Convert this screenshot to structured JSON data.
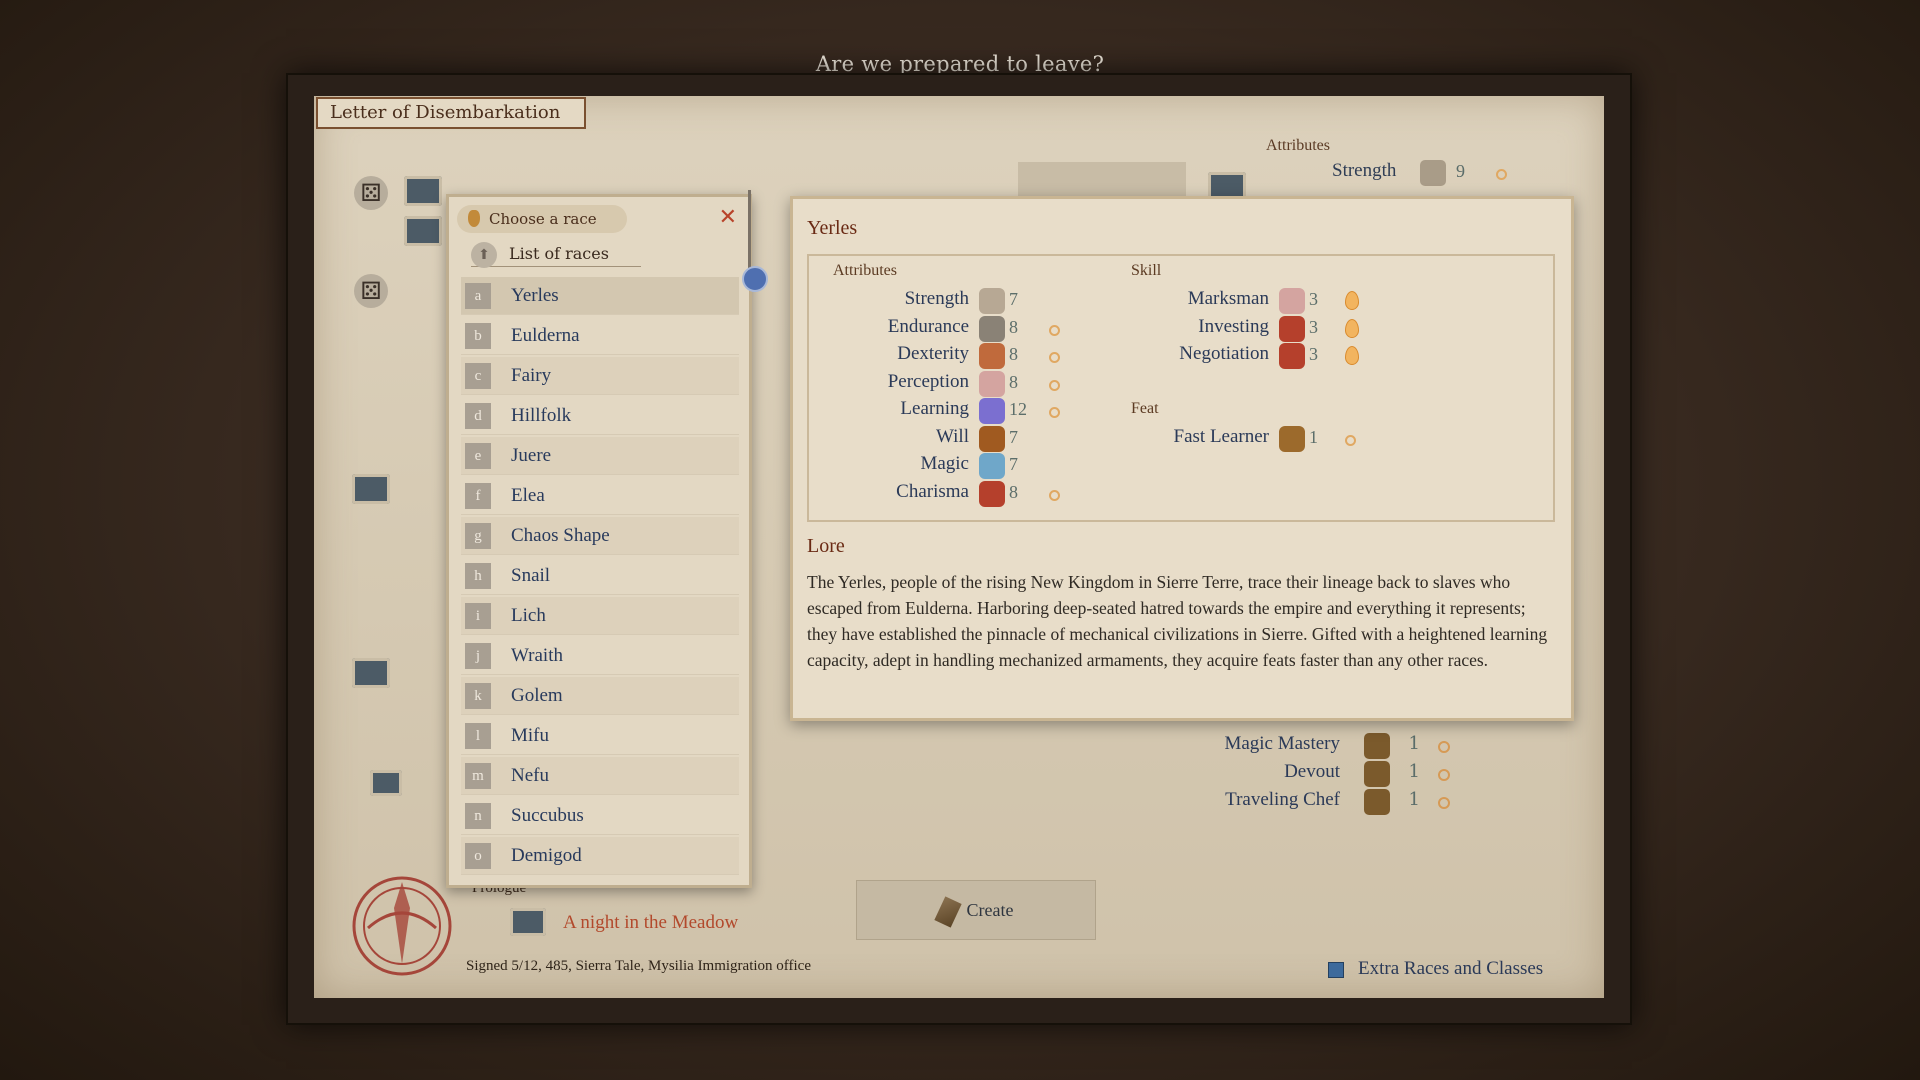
{
  "top_question": "Are we prepared to leave?",
  "letter_tab": "Letter of Disembarkation",
  "under": {
    "attributes_head": "Attributes",
    "strength_label": "Strength",
    "strength_value": "9",
    "feats": [
      {
        "name": "Magic Mastery",
        "value": "1"
      },
      {
        "name": "Devout",
        "value": "1"
      },
      {
        "name": "Traveling Chef",
        "value": "1"
      }
    ],
    "prologue_label": "Prologue",
    "prologue_link": "A night in the Meadow",
    "create_label": "Create",
    "signed": "Signed 5/12, 485, Sierra Tale, Mysilia Immigration office",
    "extra_label": "Extra Races and Classes"
  },
  "race_popup": {
    "header": "Choose a race",
    "list_label": "List of races",
    "races": [
      {
        "key": "a",
        "name": "Yerles"
      },
      {
        "key": "b",
        "name": "Eulderna"
      },
      {
        "key": "c",
        "name": "Fairy"
      },
      {
        "key": "d",
        "name": "Hillfolk"
      },
      {
        "key": "e",
        "name": "Juere"
      },
      {
        "key": "f",
        "name": "Elea"
      },
      {
        "key": "g",
        "name": "Chaos Shape"
      },
      {
        "key": "h",
        "name": "Snail"
      },
      {
        "key": "i",
        "name": "Lich"
      },
      {
        "key": "j",
        "name": "Wraith"
      },
      {
        "key": "k",
        "name": "Golem"
      },
      {
        "key": "l",
        "name": "Mifu"
      },
      {
        "key": "m",
        "name": "Nefu"
      },
      {
        "key": "n",
        "name": "Succubus"
      },
      {
        "key": "o",
        "name": "Demigod"
      }
    ],
    "selected_index": 0
  },
  "detail": {
    "title": "Yerles",
    "attributes_head": "Attributes",
    "skill_head": "Skill",
    "feat_head": "Feat",
    "attributes": [
      {
        "name": "Strength",
        "value": "7",
        "icon": "sword-icon",
        "color": "#b7a894",
        "bonus": false
      },
      {
        "name": "Endurance",
        "value": "8",
        "icon": "shield-icon",
        "color": "#8a8276",
        "bonus": true
      },
      {
        "name": "Dexterity",
        "value": "8",
        "icon": "hand-icon",
        "color": "#c06a3c",
        "bonus": true
      },
      {
        "name": "Perception",
        "value": "8",
        "icon": "eye-icon",
        "color": "#d4a4a0",
        "bonus": true
      },
      {
        "name": "Learning",
        "value": "12",
        "icon": "book-icon",
        "color": "#7b6fd0",
        "bonus": true
      },
      {
        "name": "Will",
        "value": "7",
        "icon": "will-icon",
        "color": "#a05a20",
        "bonus": false
      },
      {
        "name": "Magic",
        "value": "7",
        "icon": "magic-icon",
        "color": "#6fa7c9",
        "bonus": false
      },
      {
        "name": "Charisma",
        "value": "8",
        "icon": "charisma-icon",
        "color": "#b5402c",
        "bonus": true
      }
    ],
    "skills": [
      {
        "name": "Marksman",
        "value": "3",
        "icon": "marksman-icon",
        "color": "#d4a4a0"
      },
      {
        "name": "Investing",
        "value": "3",
        "icon": "investing-icon",
        "color": "#b5402c"
      },
      {
        "name": "Negotiation",
        "value": "3",
        "icon": "negotiation-icon",
        "color": "#b5402c"
      }
    ],
    "feats": [
      {
        "name": "Fast Learner",
        "value": "1",
        "icon": "feat-icon",
        "color": "#9c6a2c"
      }
    ],
    "lore_title": "Lore",
    "lore_text": "The Yerles, people of the rising New Kingdom in Sierre Terre, trace their lineage back to slaves who escaped from Eulderna. Harboring deep-seated hatred towards the empire and everything it represents; they have established the pinnacle of mechanical civilizations in Sierre. Gifted with a heightened learning capacity, adept in handling mechanized armaments, they acquire feats faster than any other races."
  }
}
